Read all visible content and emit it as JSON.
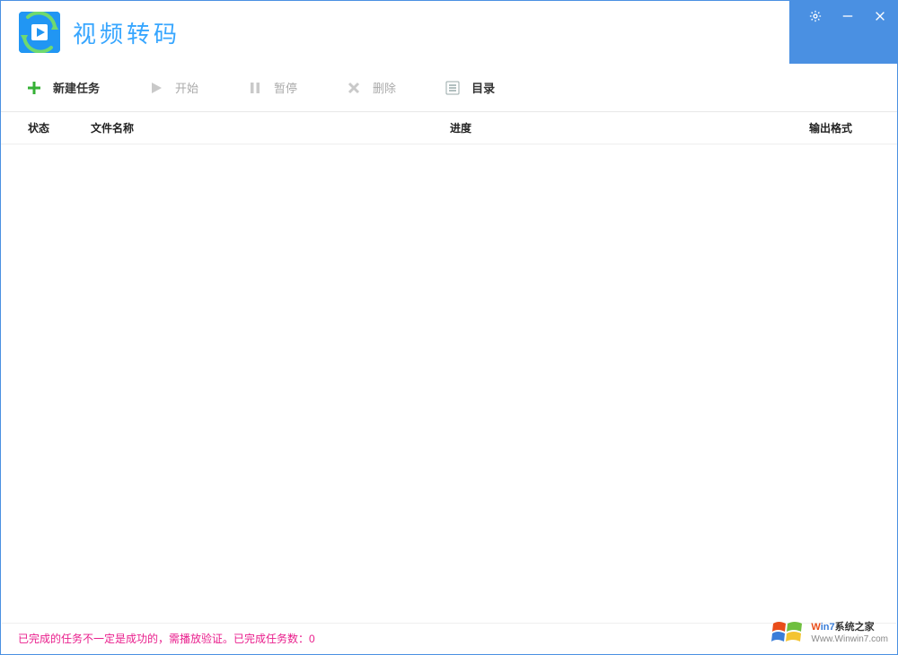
{
  "app": {
    "title": "视频转码"
  },
  "toolbar": {
    "new_task": "新建任务",
    "start": "开始",
    "pause": "暂停",
    "delete": "删除",
    "directory": "目录"
  },
  "columns": {
    "status": "状态",
    "filename": "文件名称",
    "progress": "进度",
    "output_format": "输出格式"
  },
  "status": {
    "message_prefix": "已完成的任务不一定是成功的，需播放验证。已完成任务数：",
    "completed_count": "0"
  },
  "watermark": {
    "line1_a": "W",
    "line1_b": "in7",
    "line1_c": "系统之家",
    "line2": "Www.Winwin7.com"
  }
}
